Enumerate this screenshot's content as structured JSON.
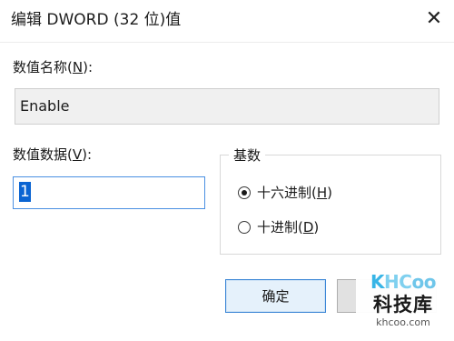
{
  "window": {
    "title": "编辑 DWORD (32 位)值",
    "close_glyph": "✕"
  },
  "value_name": {
    "label": "数值名称(",
    "hotkey": "N",
    "label_end": "):",
    "value": "Enable"
  },
  "value_data": {
    "label": "数值数据(",
    "hotkey": "V",
    "label_end": "):",
    "value": "1"
  },
  "base": {
    "title": "基数",
    "options": [
      {
        "label": "十六进制(",
        "hotkey": "H",
        "label_end": ")",
        "selected": true
      },
      {
        "label": "十进制(",
        "hotkey": "D",
        "label_end": ")",
        "selected": false
      }
    ]
  },
  "buttons": {
    "ok_label": "确定"
  },
  "watermark": {
    "logo_k": "K",
    "logo_hc": "HC",
    "logo_coo": "oo",
    "cn": "科技库",
    "url": "khcoo.com"
  },
  "colors": {
    "focus_border": "#4a90e2",
    "selection": "#0a64d2",
    "ok_border": "#3b86d6",
    "ok_bg": "#e5f1fb"
  }
}
